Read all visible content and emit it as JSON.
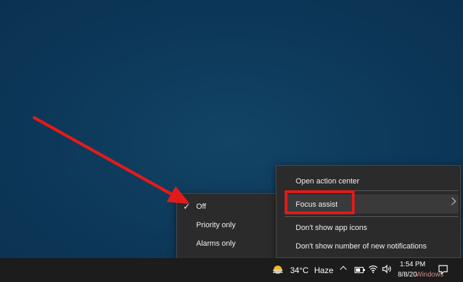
{
  "submenu": {
    "items": [
      {
        "label": "Off",
        "checked": true
      },
      {
        "label": "Priority only",
        "checked": false
      },
      {
        "label": "Alarms only",
        "checked": false
      }
    ],
    "check_glyph": "✓"
  },
  "context_menu": {
    "open_action_center": "Open action center",
    "focus_assist": "Focus assist",
    "dont_show_app_icons": "Don't show app icons",
    "dont_show_number": "Don't show number of new notifications"
  },
  "taskbar": {
    "weather_icon": "sun-haze-icon",
    "temperature": "34°C",
    "condition": "Haze",
    "time": "1:54 PM",
    "date": "8/8/20",
    "watermark": "Windows",
    "battery_level": 0.7
  },
  "annotations": {
    "highlight_color": "#e11b1b"
  }
}
